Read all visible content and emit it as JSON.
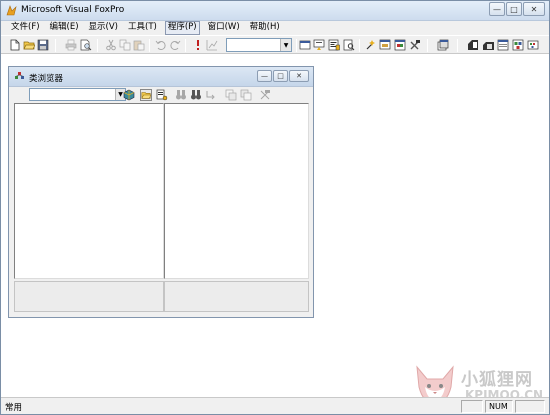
{
  "app": {
    "title": "Microsoft Visual FoxPro",
    "window_buttons": {
      "minimize": "—",
      "maximize": "□",
      "close": "✕"
    }
  },
  "menubar": {
    "items": [
      {
        "label": "文件(F)"
      },
      {
        "label": "编辑(E)"
      },
      {
        "label": "显示(V)"
      },
      {
        "label": "工具(T)"
      },
      {
        "label": "程序(P)"
      },
      {
        "label": "窗口(W)"
      },
      {
        "label": "帮助(H)"
      }
    ],
    "selected_index": 4
  },
  "toolbar": {
    "combo_value": "",
    "combo_arrow": "▼",
    "icons": [
      "new-file",
      "open-folder",
      "save",
      "print",
      "print-preview",
      "cut",
      "copy",
      "paste",
      "undo",
      "redo",
      "run",
      "modify-form",
      "command-window",
      "properties",
      "code",
      "data-session",
      "builder",
      "form-wizard",
      "report-wizard",
      "layout",
      "form-designer",
      "report",
      "query",
      "view",
      "class-browser"
    ]
  },
  "class_browser": {
    "title": "类浏览器",
    "combo_value": "",
    "combo_arrow": "▼",
    "window_buttons": {
      "minimize": "—",
      "maximize": "□",
      "close": "✕"
    }
  },
  "statusbar": {
    "text": "常用",
    "num_lock": "NUM"
  },
  "watermark": {
    "line1": "小狐狸网",
    "line2": "KPIMOO.CN"
  },
  "colors": {
    "titlebar": "#cddcee",
    "chrome": "#f0f0f0",
    "border": "#7a8ea6"
  }
}
